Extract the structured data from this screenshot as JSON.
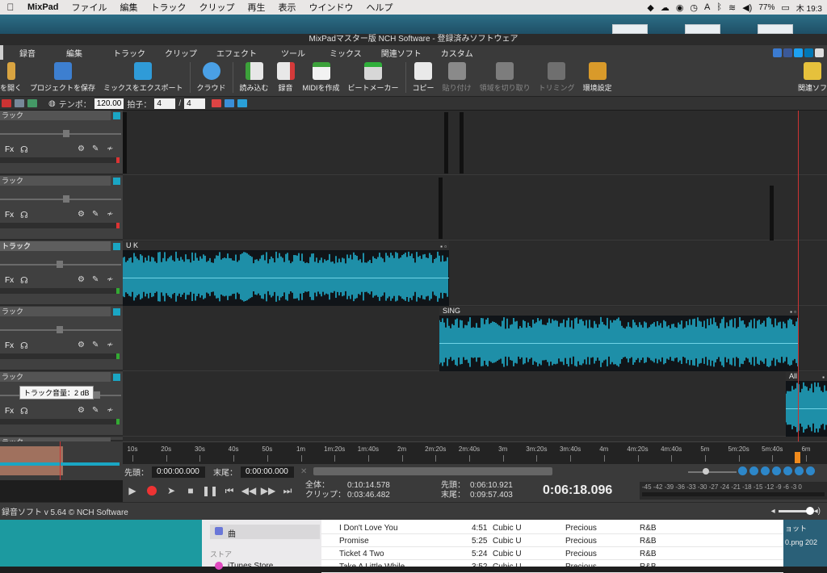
{
  "menubar": {
    "app": "MixPad",
    "items": [
      "ファイル",
      "編集",
      "トラック",
      "クリップ",
      "再生",
      "表示",
      "ウインドウ",
      "ヘルプ"
    ],
    "battery": "77%",
    "clock": "木 19:3"
  },
  "window": {
    "title": "MixPadマスター版 NCH Software - 登録済みソフトウェア"
  },
  "tabs": [
    "録音",
    "編集",
    "トラック",
    "クリップ",
    "エフェクト",
    "ツール",
    "ミックス",
    "関連ソフト",
    "カスタム"
  ],
  "toolbar": {
    "items": [
      {
        "label": "を開く",
        "icon": "folder-icon"
      },
      {
        "label": "プロジェクトを保存",
        "icon": "save-project-icon"
      },
      {
        "label": "ミックスをエクスポート",
        "icon": "export-mix-icon"
      },
      {
        "label": "クラウド",
        "icon": "cloud-icon"
      },
      {
        "label": "読み込む",
        "icon": "import-icon"
      },
      {
        "label": "録音",
        "icon": "record-icon"
      },
      {
        "label": "MIDIを作成",
        "icon": "midi-icon"
      },
      {
        "label": "ビートメーカー",
        "icon": "beatmaker-icon"
      },
      {
        "label": "コピー",
        "icon": "copy-icon"
      },
      {
        "label": "貼り付け",
        "icon": "paste-icon"
      },
      {
        "label": "領域を切り取り",
        "icon": "cut-region-icon"
      },
      {
        "label": "トリミング",
        "icon": "trim-icon"
      },
      {
        "label": "環境設定",
        "icon": "settings-icon"
      },
      {
        "label": "関連ソフ",
        "icon": "related-software-icon"
      }
    ]
  },
  "tempo": {
    "label": "テンポ：",
    "value": "120.00",
    "beat_label": "拍子：",
    "beat_num": "4",
    "slash": "/",
    "beat_den": "4"
  },
  "tracks": [
    {
      "name": "ラック"
    },
    {
      "name": "ラック"
    },
    {
      "name": "トラック"
    },
    {
      "name": "ラック"
    },
    {
      "name": "ラック"
    },
    {
      "name": "ラック"
    }
  ],
  "track_controls": {
    "fx": "Fx"
  },
  "tooltip": "トラック音量：2 dB",
  "clips": {
    "uk": "U K",
    "sing": "SING",
    "all": "All"
  },
  "ruler": [
    "10s",
    "20s",
    "30s",
    "40s",
    "50s",
    "1m",
    "1m:20s",
    "1m:40s",
    "2m",
    "2m:20s",
    "2m:40s",
    "3m",
    "3m:20s",
    "3m:40s",
    "4m",
    "4m:20s",
    "4m:40s",
    "5m",
    "5m:20s",
    "5m:40s",
    "6m",
    "6m:20s"
  ],
  "selection": {
    "start_label": "先頭：",
    "start": "0:00:00.000",
    "end_label": "末尾：",
    "end": "0:00:00.000"
  },
  "transport": {
    "total_label": "全体：",
    "total": "0:10:14.578",
    "clip_label": "クリップ：",
    "clip": "0:03:46.482",
    "head_label": "先頭：",
    "head": "0:06:10.921",
    "tail_label": "末尾：",
    "tail": "0:09:57.403",
    "current": "0:06:18.096",
    "vu_scale": "-45 -42 -39 -36 -33 -30 -27 -24 -21 -18 -15 -12 -9 -6 -3 0"
  },
  "status": {
    "text": "録音ソフト v 5.64 © NCH Software"
  },
  "itunes": {
    "sidebar": [
      "曲",
      "ストア",
      "iTunes Store"
    ],
    "rows": [
      {
        "title": "I Don't Love You",
        "time": "4:51",
        "artist": "Cubic U",
        "album": "Precious",
        "genre": "R&B"
      },
      {
        "title": "Promise",
        "time": "5:25",
        "artist": "Cubic U",
        "album": "Precious",
        "genre": "R&B"
      },
      {
        "title": "Ticket 4 Two",
        "time": "5:24",
        "artist": "Cubic U",
        "album": "Precious",
        "genre": "R&B"
      },
      {
        "title": "Take A Little While",
        "time": "3:52",
        "artist": "Cubic U",
        "album": "Precious",
        "genre": "R&B"
      }
    ],
    "desk_label": "ョット",
    "desk_file": "0.png 202"
  }
}
